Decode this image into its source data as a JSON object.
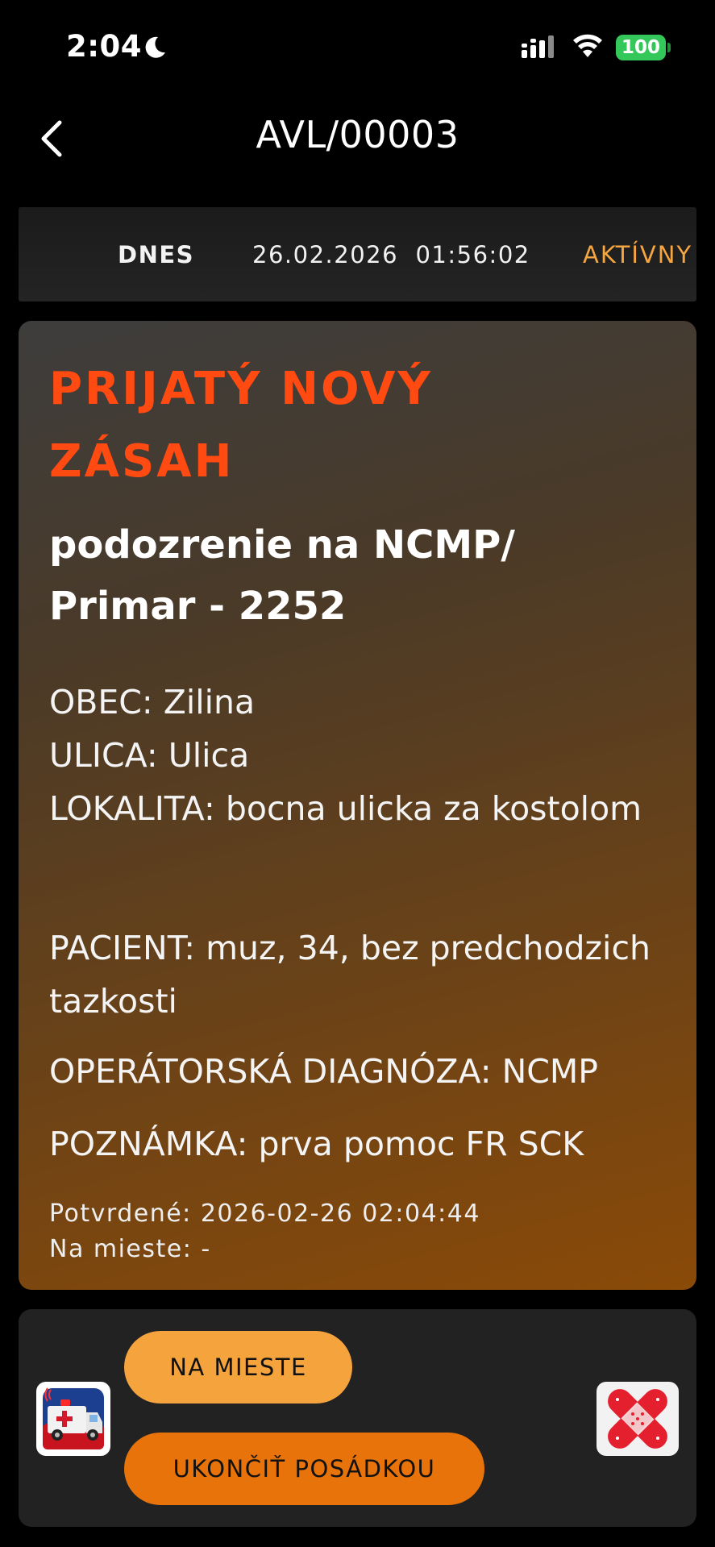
{
  "status_bar": {
    "time": "2:04",
    "battery": "100"
  },
  "nav": {
    "title": "AVL/00003"
  },
  "info_strip": {
    "day": "DNES",
    "datetime": "26.02.2026  01:56:02",
    "status": "AKTÍVNY",
    "status_color": "#f5a640"
  },
  "incident": {
    "heading": "PRIJATÝ NOVÝ ZÁSAH",
    "heading_color": "#ff4a12",
    "subheading": "podozrenie na NCMP/ Primar - 2252",
    "obec": "OBEC: Zilina",
    "ulica": "ULICA: Ulica",
    "lokalita": "LOKALITA: bocna ulicka za kostolom",
    "pacient": "PACIENT: muz, 34, bez predchodzich tazkosti",
    "diagnoza": "OPERÁTORSKÁ DIAGNÓZA: NCMP",
    "poznamka": "POZNÁMKA: prva pomoc FR SCK",
    "potvrdene": "Potvrdené: 2026-02-26 02:04:44",
    "na_mieste": "Na mieste: -"
  },
  "actions": {
    "on_site_label": "NA MIESTE",
    "end_crew_label": "UKONČIŤ POSÁDKOU",
    "left_icon": "ambulance-icon",
    "right_icon": "bandage-icon"
  }
}
